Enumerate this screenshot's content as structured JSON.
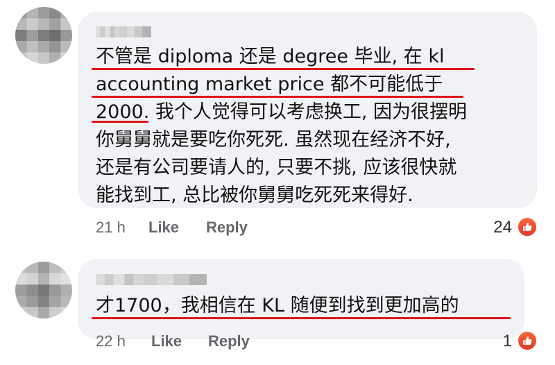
{
  "comments": [
    {
      "lines": [
        "不管是 diploma 还是 degree 毕业, 在 kl",
        "accounting market price 都不可能低于",
        "2000. 我个人觉得可以考虑换工, 因为很摆明",
        "你舅舅就是要吃你死死. 虽然现在经济不好,",
        "还是有公司要请人的, 只要不挑, 应该很快就",
        "能找到工, 总比被你舅舅吃死死来得好."
      ],
      "time": "21 h",
      "like_label": "Like",
      "reply_label": "Reply",
      "reaction_count": "24",
      "reaction_icon": "like-reaction-icon"
    },
    {
      "lines": [
        "才1700，我相信在 KL 随便到找到更加高的"
      ],
      "time": "22 h",
      "like_label": "Like",
      "reply_label": "Reply",
      "reaction_count": "1",
      "reaction_icon": "like-reaction-icon"
    }
  ],
  "colors": {
    "bubble": "#f0f2f5",
    "underline": "#e0151c",
    "meta": "#65676b",
    "reaction": "#e8452e"
  }
}
